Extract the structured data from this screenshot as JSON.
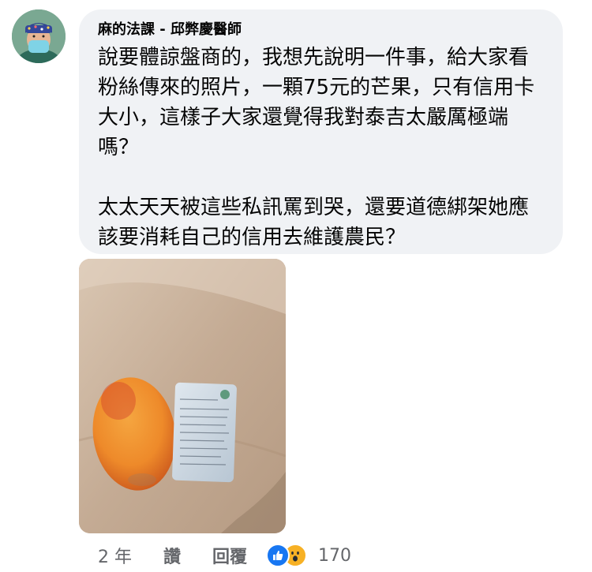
{
  "comment": {
    "author": "麻的法課 - 邱弊慶醫師",
    "paragraphs": [
      "說要體諒盤商的，我想先說明一件事，給大家看粉絲傳來的照片，一顆75元的芒果，只有信用卡大小，這樣子大家還覺得我對泰吉太嚴厲極端嗎？",
      "太太天天被這些私訊罵到哭，還要道德綁架她應該要消耗自己的信用去維護農民？"
    ]
  },
  "attachment": {
    "icon": "photo-mango-and-card"
  },
  "actions": {
    "time": "2 年",
    "like_label": "讚",
    "reply_label": "回覆",
    "reactions": [
      "thumbs-up-icon",
      "wow-face-icon"
    ],
    "reaction_count": "170"
  },
  "colors": {
    "bubble": "#f0f2f5",
    "meta_text": "#65676b",
    "like_blue": "#1877f2",
    "wow_yellow": "#f7b125"
  }
}
